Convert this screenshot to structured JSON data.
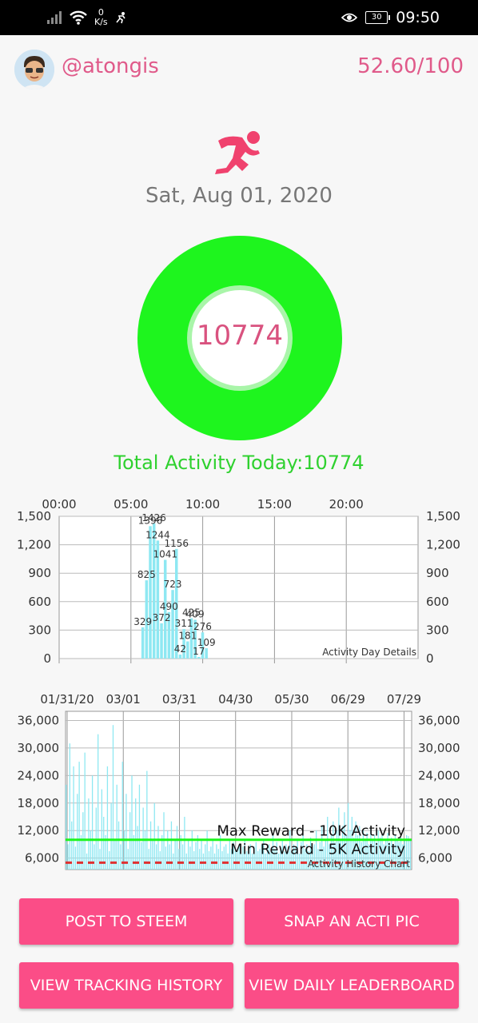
{
  "status_bar": {
    "net_speed": "0",
    "net_unit": "K/s",
    "battery": "30",
    "time": "09:50"
  },
  "header": {
    "username": "@atongis",
    "score": "52.60/100"
  },
  "date": "Sat, Aug 01, 2020",
  "ring": {
    "value": "10774",
    "fraction": 1.0,
    "color": "#1ef51e"
  },
  "total_activity": "Total Activity Today:10774",
  "colors": {
    "accent": "#fb4d87",
    "pink_text": "#e05a8a",
    "green": "#1ef51e",
    "bar": "#8ee8f2"
  },
  "chart_data": [
    {
      "type": "bar",
      "label": "Activity Day Details",
      "x_ticks": [
        "00:00",
        "05:00",
        "10:00",
        "15:00",
        "20:00"
      ],
      "y_ticks": [
        "0",
        "300",
        "600",
        "900",
        "1,200",
        "1,500"
      ],
      "ylim": [
        0,
        1500
      ],
      "xlim": [
        0,
        24
      ],
      "x": [
        5.5,
        5.75,
        6.0,
        6.25,
        6.5,
        6.75,
        7.0,
        7.25,
        7.5,
        7.75,
        8.0,
        8.25,
        8.5,
        8.75,
        9.0,
        9.25,
        9.5,
        9.75
      ],
      "values": [
        329,
        825,
        1396,
        1426,
        1244,
        372,
        1041,
        490,
        723,
        1156,
        42,
        311,
        181,
        425,
        409,
        17,
        276,
        109
      ],
      "labels": [
        "329",
        "825",
        "1396",
        "1426",
        "1244",
        "372",
        "1041",
        "490",
        "723",
        "1156",
        "42",
        "311",
        "181",
        "425",
        "409",
        "17",
        "276",
        "109"
      ]
    },
    {
      "type": "bar",
      "label": "Activity History Chart",
      "x_ticks": [
        "01/31/20",
        "03/01",
        "03/31",
        "04/30",
        "05/30",
        "06/29",
        "07/29"
      ],
      "y_ticks": [
        "6,000",
        "12,000",
        "18,000",
        "24,000",
        "30,000",
        "36,000"
      ],
      "ylim": [
        3500,
        38000
      ],
      "days": 184,
      "values": [
        22000,
        9000,
        31000,
        14000,
        26000,
        8500,
        20000,
        27000,
        11000,
        16000,
        29000,
        7000,
        19000,
        12000,
        24000,
        9000,
        17000,
        33000,
        8000,
        21000,
        15000,
        11000,
        26000,
        7500,
        18000,
        35000,
        10000,
        22000,
        14000,
        9000,
        27000,
        12000,
        20000,
        8000,
        16000,
        24000,
        11000,
        19000,
        13000,
        22000,
        9500,
        17000,
        12000,
        25000,
        8000,
        14000,
        10000,
        18000,
        9000,
        13000,
        7500,
        11000,
        16000,
        8500,
        12000,
        9000,
        14000,
        7000,
        10000,
        13000,
        8000,
        11000,
        9000,
        15000,
        7000,
        10000,
        8500,
        12000,
        7500,
        9500,
        11000,
        8000,
        10000,
        7000,
        9000,
        12000,
        7500,
        8500,
        10000,
        7000,
        9000,
        8000,
        11000,
        7500,
        8500,
        9000,
        7000,
        10000,
        8000,
        9500,
        7500,
        8000,
        9000,
        7000,
        8500,
        10000,
        7500,
        8000,
        9000,
        7000,
        8500,
        9500,
        7500,
        8000,
        9000,
        10000,
        7000,
        8500,
        9000,
        7500,
        11000,
        8000,
        9500,
        7000,
        8500,
        10000,
        7500,
        9000,
        8000,
        12000,
        7500,
        9000,
        8500,
        10000,
        7000,
        9500,
        11000,
        8000,
        9000,
        7500,
        10500,
        8500,
        9000,
        12000,
        8000,
        9500,
        13000,
        8500,
        10000,
        15000,
        9000,
        11000,
        14000,
        9500,
        12000,
        17000,
        10000,
        13000,
        16000,
        11000,
        18000,
        12000,
        15000,
        10500,
        14000,
        11000,
        13000,
        9500,
        12000,
        10000,
        11500,
        9000,
        12500,
        10000,
        11000,
        9500,
        12000,
        10500,
        11000,
        9000,
        10000,
        11500,
        9500,
        10500,
        9000,
        11000,
        10000,
        9500,
        10500,
        9000,
        10000,
        11000,
        10774,
        10000
      ],
      "reference_lines": [
        {
          "name": "Max Reward - 10K Activity",
          "value": 10000,
          "color": "#1ef51e",
          "style": "solid"
        },
        {
          "name": "Min Reward - 5K Activity",
          "value": 5000,
          "color": "#e03030",
          "style": "dashed"
        }
      ]
    }
  ],
  "buttons": {
    "post": "POST TO STEEM",
    "snap": "SNAP AN ACTI PIC",
    "history": "VIEW TRACKING HISTORY",
    "leaderboard": "VIEW DAILY LEADERBOARD"
  }
}
